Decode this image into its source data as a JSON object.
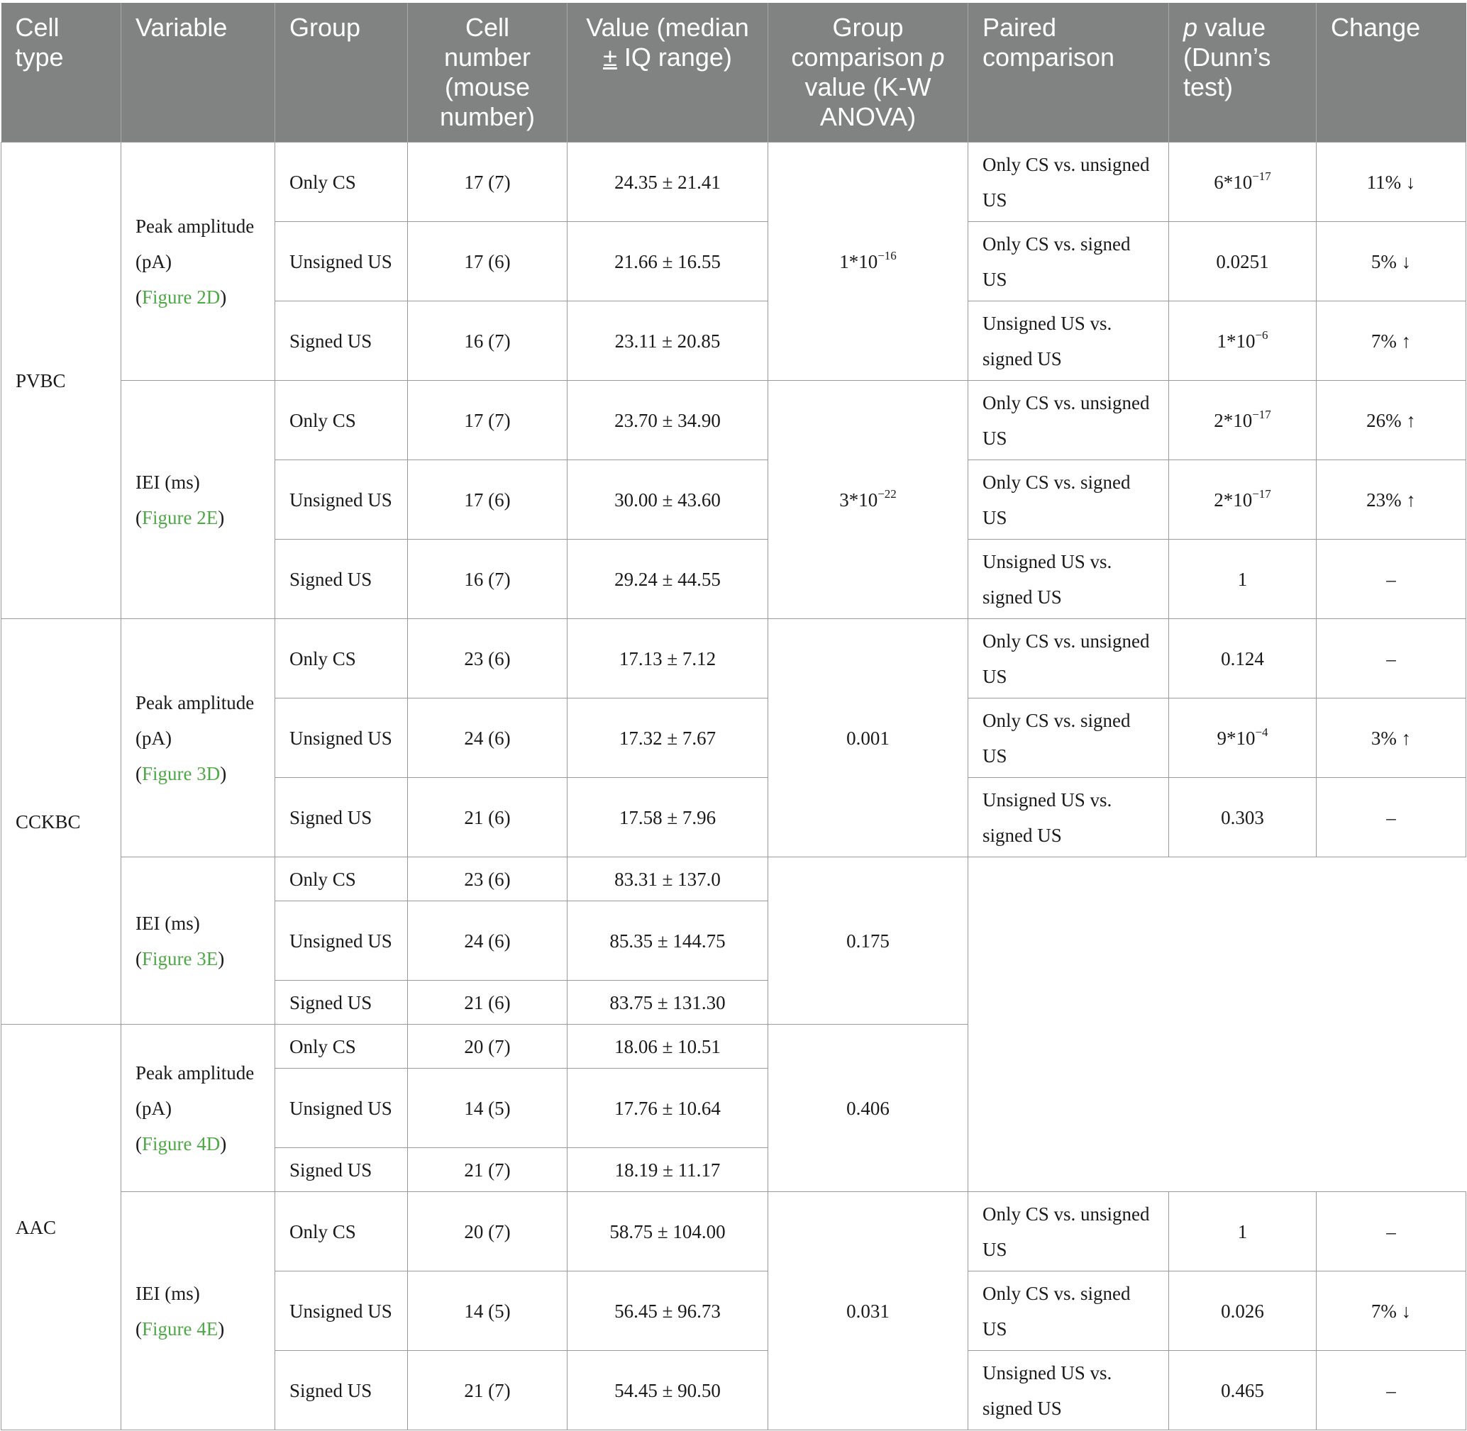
{
  "headers": {
    "cell_type": "Cell type",
    "variable": "Variable",
    "group": "Group",
    "cell_number": "Cell number (mouse number)",
    "value": "Value (median",
    "value_pm": "±",
    "value_rest": "IQ range)",
    "group_comparison": "Group comparison",
    "group_comparison_p": "p",
    "group_comparison_rest": "value (K-W ANOVA)",
    "paired_comparison": "Paired comparison",
    "p_value_italic": "p",
    "p_value_rest": "value (Dunn’s test)",
    "change": "Change"
  },
  "cell_types": {
    "pvbc": "PVBC",
    "cckbc": "CCKBC",
    "aac": "AAC"
  },
  "variables": {
    "peak_amplitude": "Peak amplitude (pA)",
    "iei": "IEI (ms)"
  },
  "figures": {
    "f2d": "Figure 2D",
    "f2e": "Figure 2E",
    "f3d": "Figure 3D",
    "f3e": "Figure 3E",
    "f4d": "Figure 4D",
    "f4e": "Figure 4E"
  },
  "paren_open": "(",
  "paren_close": ")",
  "groups": {
    "only_cs": "Only CS",
    "unsigned_us": "Unsigned US",
    "signed_us": "Signed US"
  },
  "comparisons": {
    "cs_vs_unsigned": "Only CS vs. unsigned US",
    "cs_vs_signed": "Only CS vs. signed US",
    "unsigned_vs_signed": "Unsigned US vs. signed US"
  },
  "rows": [
    {
      "n": "17 (7)",
      "value": "24.35 ± 21.41",
      "p": "6*10",
      "p_exp": "−17",
      "change": "11% ↓"
    },
    {
      "n": "17 (6)",
      "value": "21.66 ± 16.55",
      "p": "0.0251",
      "p_exp": "",
      "change": "5% ↓"
    },
    {
      "n": "16 (7)",
      "value": "23.11 ± 20.85",
      "p": "1*10",
      "p_exp": "−6",
      "change": "7% ↑"
    },
    {
      "n": "17 (7)",
      "value": "23.70 ± 34.90",
      "p": "2*10",
      "p_exp": "−17",
      "change": "26% ↑"
    },
    {
      "n": "17 (6)",
      "value": "30.00 ± 43.60",
      "p": "2*10",
      "p_exp": "−17",
      "change": "23% ↑"
    },
    {
      "n": "16 (7)",
      "value": "29.24 ± 44.55",
      "p": "1",
      "p_exp": "",
      "change": "–"
    },
    {
      "n": "23 (6)",
      "value": "17.13 ± 7.12",
      "p": "0.124",
      "p_exp": "",
      "change": "–"
    },
    {
      "n": "24 (6)",
      "value": "17.32 ± 7.67",
      "p": "9*10",
      "p_exp": "−4",
      "change": "3% ↑"
    },
    {
      "n": "21 (6)",
      "value": "17.58 ± 7.96",
      "p": "0.303",
      "p_exp": "",
      "change": "–"
    },
    {
      "n": "23 (6)",
      "value": "83.31 ± 137.0"
    },
    {
      "n": "24 (6)",
      "value": "85.35 ± 144.75"
    },
    {
      "n": "21 (6)",
      "value": "83.75 ± 131.30"
    },
    {
      "n": "20 (7)",
      "value": "18.06 ± 10.51"
    },
    {
      "n": "14 (5)",
      "value": "17.76 ± 10.64"
    },
    {
      "n": "21 (7)",
      "value": "18.19 ± 11.17"
    },
    {
      "n": "20 (7)",
      "value": "58.75 ± 104.00",
      "p": "1",
      "p_exp": "",
      "change": "–"
    },
    {
      "n": "14 (5)",
      "value": "56.45 ± 96.73",
      "p": "0.026",
      "p_exp": "",
      "change": "7% ↓"
    },
    {
      "n": "21 (7)",
      "value": "54.45 ± 90.50",
      "p": "0.465",
      "p_exp": "",
      "change": "–"
    }
  ],
  "group_p": [
    {
      "base": "1*10",
      "exp": "−16"
    },
    {
      "base": "3*10",
      "exp": "−22"
    },
    {
      "base": "0.001",
      "exp": ""
    },
    {
      "base": "0.175",
      "exp": ""
    },
    {
      "base": "0.406",
      "exp": ""
    },
    {
      "base": "0.031",
      "exp": ""
    }
  ]
}
